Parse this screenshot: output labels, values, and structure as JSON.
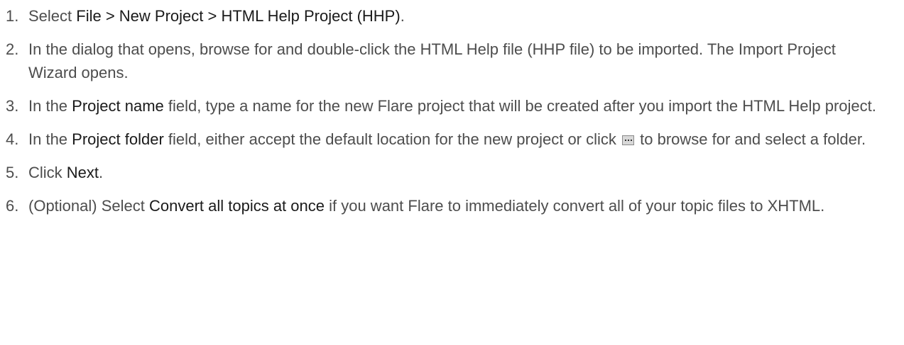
{
  "steps": [
    {
      "num": "1.",
      "t1": "Select ",
      "b1": "File > New Project > HTML Help Project (HHP)",
      "t2": "."
    },
    {
      "num": "2.",
      "t1": "In the dialog that opens, browse for and double-click the HTML Help file (HHP file) to be imported. The Import Project Wizard opens."
    },
    {
      "num": "3.",
      "t1": "In the ",
      "b1": "Project name",
      "t2": " field, type a name for the new Flare project that will be created after you import the HTML Help project."
    },
    {
      "num": "4.",
      "t1": "In the ",
      "b1": "Project folder",
      "t2": " field, either accept the default location for the new project or click ",
      "icon": "browse-ellipsis-icon",
      "t3": " to browse for and select a folder."
    },
    {
      "num": "5.",
      "t1": "Click ",
      "b1": "Next",
      "t2": "."
    },
    {
      "num": "6.",
      "t1": "(Optional) Select ",
      "b1": "Convert all topics at once",
      "t2": " if you want Flare to immediately convert all of your topic files to XHTML."
    }
  ],
  "colors": {
    "body_text": "#4d4d4d",
    "emphasis_text": "#1a1a1a",
    "background": "#ffffff"
  }
}
